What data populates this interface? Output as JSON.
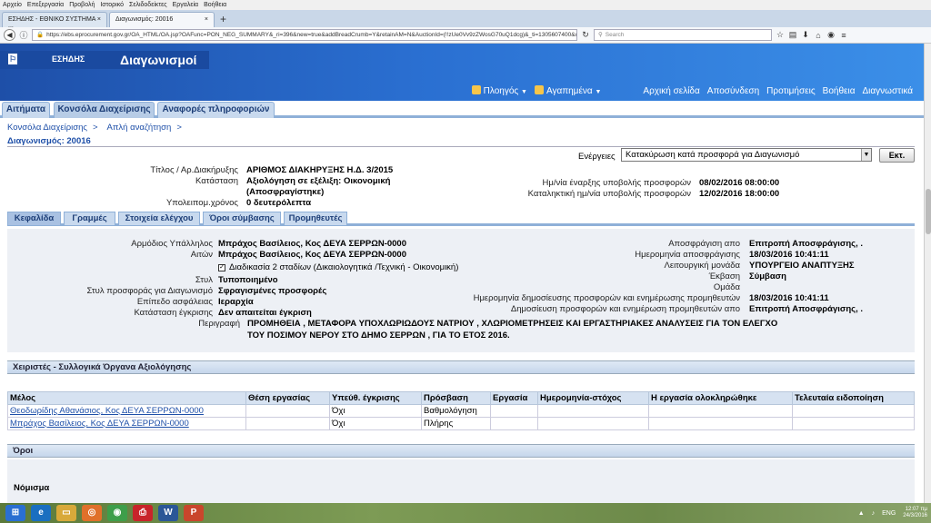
{
  "browser": {
    "menu": [
      "Αρχείο",
      "Επεξεργασία",
      "Προβολή",
      "Ιστορικό",
      "Σελιδοδείκτες",
      "Εργαλεία",
      "Βοήθεια"
    ],
    "tabs": [
      {
        "title": "ΕΣΗΔΗΣ - ΕΘΝΙΚΟ ΣΥΣΤΗΜΑ ..."
      },
      {
        "title": "Διαγωνισμός: 20016"
      }
    ],
    "new_tab": "+",
    "url": "https://ebs.eprocurement.gov.gr/OA_HTML/OA.jsp?OAFunc=PON_NEG_SUMMARY&_ri=396&new=true&addBreadCrumb=Y&retainAM=N&AuctionId=(!!zUe0Vv9zZWosG70uQ1dcg)&_ti=1305607400&oapc=8&oas=8h9L",
    "search_placeholder": "Search"
  },
  "header": {
    "brand": "ΕΣΗΔΗΣ",
    "title": "Διαγωνισμοί",
    "nav": {
      "navigation": "Πλοηγός",
      "favorites": "Αγαπημένα"
    },
    "links": [
      "Αρχική σελίδα",
      "Αποσύνδεση",
      "Προτιμήσεις",
      "Βοήθεια",
      "Διαγνωστικά"
    ]
  },
  "app_tabs": [
    "Αιτήματα",
    "Κονσόλα Διαχείρισης",
    "Αναφορές πληροφοριών"
  ],
  "breadcrumbs": [
    "Κονσόλα Διαχείρισης",
    ">",
    "Απλή αναζήτηση",
    ">"
  ],
  "page_title": "Διαγωνισμός: 20016",
  "actions": {
    "label": "Ενέργειες",
    "selected": "Κατακύρωση κατά προσφορά για Διαγωνισμό",
    "button": "Εκτ."
  },
  "summary": {
    "title_label": "Τίτλος / Αρ.Διακήρυξης",
    "title_value": "ΑΡΙΘΜΟΣ ΔΙΑΚΗΡΥΞΗΣ Η.Δ. 3/2015",
    "status_label": "Κατάσταση",
    "status_value_1": "Αξιολόγηση σε εξέλιξη: Οικονομική",
    "status_value_2": "(Αποσφραγίστηκε)",
    "remaining_label": "Υπολειπομ.χρόνος",
    "remaining_value": "0 δευτερόλεπτα",
    "start_label": "Ημ/νία έναρξης υποβολής προσφορών",
    "start_value": "08/02/2016 08:00:00",
    "end_label": "Καταληκτική ημ/νία υποβολής προσφορών",
    "end_value": "12/02/2016 18:00:00"
  },
  "sub_tabs": [
    "Κεφαλίδα",
    "Γραμμές",
    "Στοιχεία ελέγχου",
    "Όροι σύμβασης",
    "Προμηθευτές"
  ],
  "header_details": {
    "officer_label": "Αρμόδιος Υπάλληλος",
    "officer_value": "Μπράχος Βασίλειος, Κος ΔΕΥΑ ΣΕΡΡΩΝ-0000",
    "requester_label": "Αιτών",
    "requester_value": "Μπράχος Βασίλειος, Κος ΔΕΥΑ ΣΕΡΡΩΝ-0000",
    "two_stage": "Διαδικασία 2 σταδίων (Δικαιολογητικά /Τεχνική - Οικονομική)",
    "style_label": "Στυλ",
    "style_value": "Τυποποιημένο",
    "offer_style_label": "Στυλ προσφοράς για Διαγωνισμό",
    "offer_style_value": "Σφραγισμένες προσφορές",
    "security_label": "Επίπεδο ασφάλειας",
    "security_value": "Ιεραρχία",
    "approval_label": "Κατάσταση έγκρισης",
    "approval_value": "Δεν απαιτείται έγκριση",
    "description_label": "Περιγραφή",
    "description_value": "ΠΡΟΜΗΘΕΙΑ , ΜΕΤΑΦΟΡΑ ΥΠΟΧΛΩΡΙΩΔΟΥΣ ΝΑΤΡΙΟΥ , ΧΛΩΡΙΟΜΕΤΡΗΣΕΙΣ ΚΑΙ ΕΡΓΑΣΤΗΡΙΑΚΕΣ ΑΝΑΛΥΣΕΙΣ ΓΙΑ ΤΟΝ ΕΛΕΓΧΟ ΤΟΥ ΠΟΣΙΜΟΥ ΝΕΡΟΥ ΣΤΟ ΔΗΜΟ ΣΕΡΡΩΝ , ΓΙΑ ΤΟ ΕΤΟΣ 2016.",
    "unseal_by_label": "Αποσφράγιση απο",
    "unseal_by_value": "Επιτροπή Αποσφράγισης, .",
    "unseal_date_label": "Ημερομηνία αποσφράγισης",
    "unseal_date_value": "18/03/2016 10:41:11",
    "unit_label": "Λειτουργική μονάδα",
    "unit_value": "ΥΠΟΥΡΓΕΙΟ ΑΝΑΠΤΥΞΗΣ",
    "outcome_label": "Έκβαση",
    "outcome_value": "Σύμβαση",
    "group_label": "Ομάδα",
    "publish_date_label": "Ημερομηνία δημοσίευσης προσφορών και ενημέρωσης προμηθευτών",
    "publish_date_value": "18/03/2016 10:41:11",
    "publish_by_label": "Δημοσίευση προσφορών και ενημέρωση προμηθευτών απο",
    "publish_by_value": "Επιτροπή Αποσφράγισης, ."
  },
  "eval_section": {
    "title": "Χειριστές - Συλλογικά Όργανα Αξιολόγησης",
    "columns": [
      "Μέλος",
      "Θέση εργασίας",
      "Υπεύθ. έγκρισης",
      "Πρόσβαση",
      "Εργασία",
      "Ημερομηνία-στόχος",
      "Η εργασία ολοκληρώθηκε",
      "Τελευταία ειδοποίηση"
    ],
    "rows": [
      [
        "Θεοδωρίδης Αθανάσιος, Κος ΔΕΥΑ ΣΕΡΡΩΝ-0000",
        "",
        "Όχι",
        "Βαθμολόγηση",
        "",
        "",
        "",
        ""
      ],
      [
        "Μπράχος Βασίλειος, Κος ΔΕΥΑ ΣΕΡΡΩΝ-0000",
        "",
        "Όχι",
        "Πλήρης",
        "",
        "",
        "",
        ""
      ]
    ]
  },
  "terms_section": {
    "title": "Όροι",
    "currency_label": "Νόμισμα"
  },
  "taskbar": {
    "lang": "ENG",
    "time": "12:07 πμ",
    "date": "24/3/2016"
  }
}
